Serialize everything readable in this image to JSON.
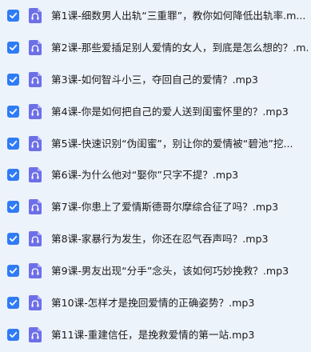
{
  "files": [
    {
      "name": "第1课-细数男人出轨“三重罪”，教你如何降低出轨率.m...",
      "checked": true
    },
    {
      "name": "第2课-那些爱插足别人爱情的女人，到底是怎么想的？.m...",
      "checked": true
    },
    {
      "name": "第3课-如何智斗小三，夺回自己的爱情？.mp3",
      "checked": true
    },
    {
      "name": "第4课-你是如何把自己的爱人送到闺蜜怀里的？.mp3",
      "checked": true
    },
    {
      "name": "第5课-快速识别“伪闺蜜”，别让你的爱情被“碧池”挖...",
      "checked": true
    },
    {
      "name": "第6课-为什么他对“娶你”只字不提？.mp3",
      "checked": true
    },
    {
      "name": "第7课-你患上了爱情斯德哥尔摩综合征了吗？.mp3",
      "checked": true
    },
    {
      "name": "第8课-家暴行为发生，你还在忍气吞声吗？.mp3",
      "checked": true
    },
    {
      "name": "第9课-男友出现“分手”念头，该如何巧妙挽救？.mp3",
      "checked": true
    },
    {
      "name": "第10课-怎样才是挽回爱情的正确姿势？.mp3",
      "checked": true
    },
    {
      "name": "第11课-重建信任，是挽救爱情的第一站.mp3",
      "checked": true
    }
  ],
  "colors": {
    "checkbox": "#2f7cf6",
    "file_icon": "#6d6fe8",
    "row_background": "#edf3fb"
  },
  "icons": {
    "checkbox": "checkmark-icon",
    "file": "audio-file-icon"
  }
}
